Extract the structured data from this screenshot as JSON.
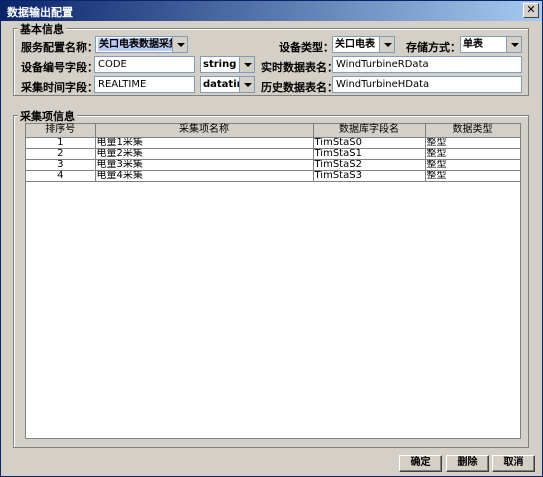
{
  "window": {
    "title": "数据输出配置"
  },
  "basic": {
    "section_title": "基本信息",
    "service_name_label": "服务配置名称：",
    "service_name_value": "关口电表数据采集",
    "device_type_label": "设备类型：",
    "device_type_value": "关口电表",
    "storage_label": "存储方式：",
    "storage_value": "单表",
    "device_code_label": "设备编号字段：",
    "device_code_value": "CODE",
    "device_code_type": "string",
    "realtime_table_label": "实时数据表名：",
    "realtime_table_value": "WindTurbineRData",
    "collect_time_label": "采集时间字段：",
    "collect_time_value": "REALTIME",
    "collect_time_type": "datatime",
    "history_table_label": "历史数据表名：",
    "history_table_value": "WindTurbineHData"
  },
  "items": {
    "section_title": "采集项信息",
    "columns": [
      "排序号",
      "采集项名称",
      "数据库字段名",
      "数据类型"
    ],
    "rows": [
      [
        "1",
        "电量1采集",
        "TimStaS0",
        "整型"
      ],
      [
        "2",
        "电量2采集",
        "TimStaS1",
        "整型"
      ],
      [
        "3",
        "电量3采集",
        "TimStaS2",
        "整型"
      ],
      [
        "4",
        "电量4采集",
        "TimStaS3",
        "整型"
      ]
    ]
  },
  "buttons": {
    "ok": "确定",
    "delete": "删除",
    "cancel": "取消"
  }
}
